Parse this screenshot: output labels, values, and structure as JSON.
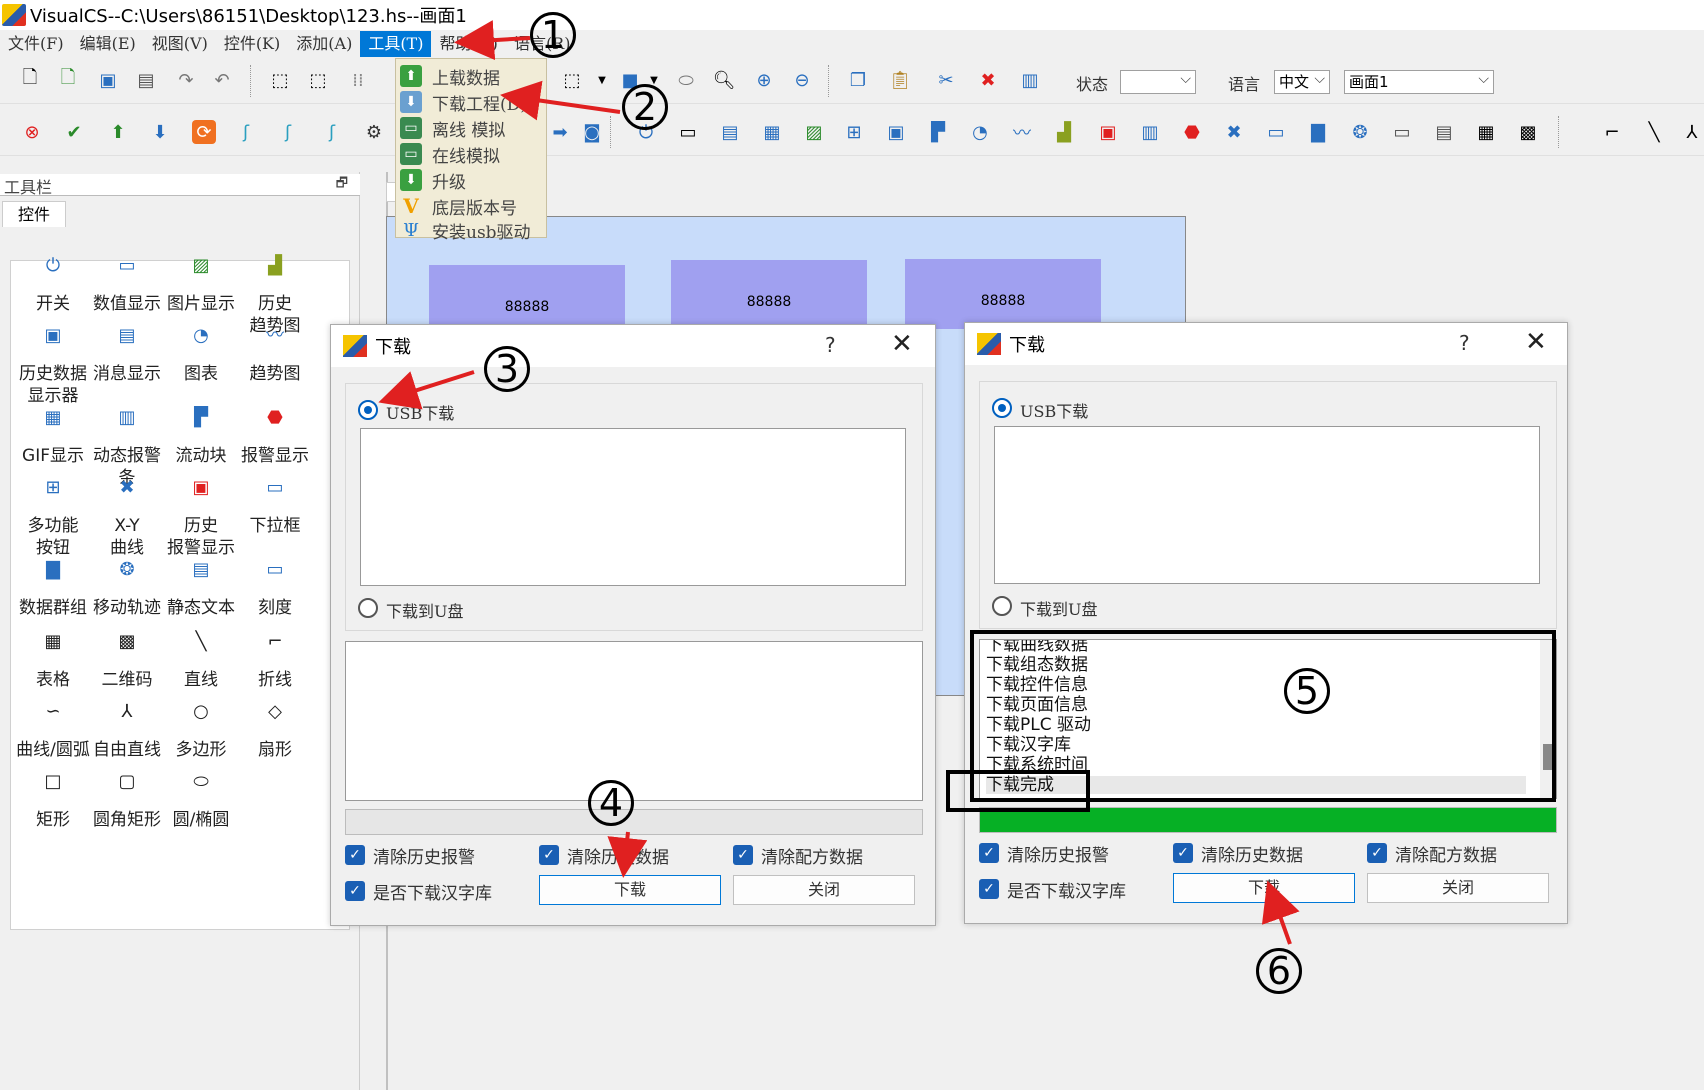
{
  "window": {
    "title": "VisualCS--C:\\Users\\86151\\Desktop\\123.hs--画面1"
  },
  "menu": [
    "文件(F)",
    "编辑(E)",
    "视图(V)",
    "控件(K)",
    "添加(A)",
    "工具(T)",
    "帮助(H)",
    "语言(R)"
  ],
  "toolbar": {
    "state_label": "状态",
    "state_value": "",
    "lang_label": "语言",
    "lang_value": "中文",
    "screen_value": "画面1"
  },
  "tools_menu": [
    "上载数据",
    "下载工程(D)",
    "离线 模拟",
    "在线模拟",
    "升级",
    "底层版本号",
    "安装usb驱动"
  ],
  "panel": {
    "title": "工具栏",
    "tab": "控件",
    "widgets": [
      {
        "label": "开关",
        "icon": "power-icon"
      },
      {
        "label": "数值显示",
        "icon": "numeric-display-icon"
      },
      {
        "label": "图片显示",
        "icon": "image-icon"
      },
      {
        "label": "历史\n趋势图",
        "icon": "history-trend-icon"
      },
      {
        "label": "历史数据\n显示器",
        "icon": "history-data-icon"
      },
      {
        "label": "消息显示",
        "icon": "message-icon"
      },
      {
        "label": "图表",
        "icon": "gauge-icon"
      },
      {
        "label": "趋势图",
        "icon": "trend-icon"
      },
      {
        "label": "GIF显示",
        "icon": "gif-icon"
      },
      {
        "label": "动态报警条",
        "icon": "alarm-bar-icon"
      },
      {
        "label": "流动块",
        "icon": "flow-block-icon"
      },
      {
        "label": "报警显示",
        "icon": "alarm-icon"
      },
      {
        "label": "多功能\n按钮",
        "icon": "multi-button-icon"
      },
      {
        "label": "X-Y\n曲线",
        "icon": "xy-curve-icon"
      },
      {
        "label": "历史\n报警显示",
        "icon": "history-alarm-icon"
      },
      {
        "label": "下拉框",
        "icon": "dropdown-icon"
      },
      {
        "label": "数据群组",
        "icon": "data-group-icon"
      },
      {
        "label": "移动轨迹",
        "icon": "track-icon"
      },
      {
        "label": "静态文本",
        "icon": "static-text-icon"
      },
      {
        "label": "刻度",
        "icon": "scale-icon"
      },
      {
        "label": "表格",
        "icon": "table-icon"
      },
      {
        "label": "二维码",
        "icon": "qrcode-icon"
      },
      {
        "label": "直线",
        "icon": "line-icon"
      },
      {
        "label": "折线",
        "icon": "polyline-icon"
      },
      {
        "label": "曲线/圆弧",
        "icon": "curve-icon"
      },
      {
        "label": "自由直线",
        "icon": "free-line-icon"
      },
      {
        "label": "多边形",
        "icon": "polygon-icon"
      },
      {
        "label": "扇形",
        "icon": "sector-icon"
      },
      {
        "label": "矩形",
        "icon": "rect-icon"
      },
      {
        "label": "圆角矩形",
        "icon": "round-rect-icon"
      },
      {
        "label": "圆/椭圆",
        "icon": "ellipse-icon"
      }
    ]
  },
  "canvas": {
    "blocks": [
      "88888",
      "88888",
      "88888"
    ]
  },
  "dialog_left": {
    "title": "下载",
    "help": "?",
    "close": "✕",
    "usb_label": "USB下载",
    "udisk_label": "下载到U盘",
    "clear_alarm": "清除历史报警",
    "clear_history": "清除历史数据",
    "clear_recipe": "清除配方数据",
    "download_font": "是否下载汉字库",
    "download_btn": "下载",
    "close_btn": "关闭"
  },
  "dialog_right": {
    "title": "下载",
    "help": "?",
    "close": "✕",
    "usb_label": "USB下载",
    "udisk_label": "下载到U盘",
    "log": [
      "下载曲线数据",
      "下载组态数据",
      "下载控件信息",
      "下载页面信息",
      "下载PLC 驱动",
      "下载汉字库",
      "下载系统时间",
      "下载完成"
    ],
    "progress": 1.0,
    "clear_alarm": "清除历史报警",
    "clear_history": "清除历史数据",
    "clear_recipe": "清除配方数据",
    "download_font": "是否下载汉字库",
    "download_btn": "下载",
    "close_btn": "关闭"
  },
  "annotations": [
    "1",
    "2",
    "3",
    "4",
    "5",
    "6"
  ],
  "colors": {
    "accent": "#0078d7",
    "progress": "#06b025",
    "arrow": "#e02020",
    "canvas": "#c8dcfa",
    "block": "#a0a0f0"
  }
}
